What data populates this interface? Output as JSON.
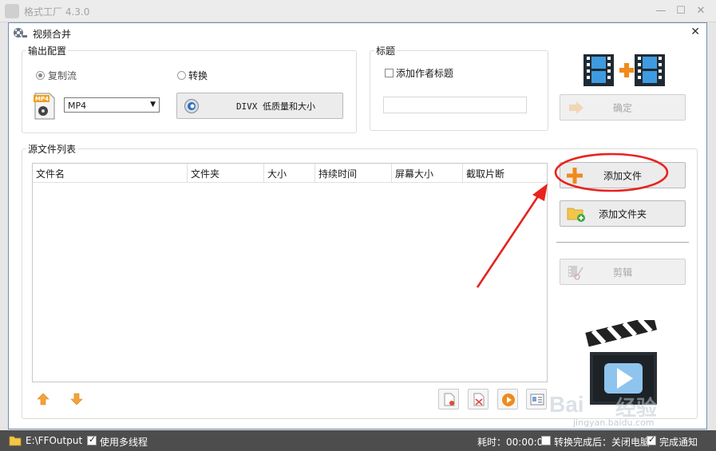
{
  "app": {
    "title": "格式工厂 4.3.0",
    "minimize": "—",
    "maximize": "☐",
    "close": "✕"
  },
  "dialog": {
    "title": "视频合并",
    "close": "✕",
    "output": {
      "group_label": "输出配置",
      "copy_stream_label": "复制流",
      "convert_label": "转换",
      "selected_mode": "复制流",
      "format_value": "MP4",
      "format_icon_text": "MP4",
      "quality_button": "DIVX 低质量和大小"
    },
    "title_group": {
      "group_label": "标题",
      "add_author_label": "添加作者标题",
      "add_author_checked": false,
      "title_value": ""
    },
    "confirm_button": "确定",
    "source_list": {
      "group_label": "源文件列表",
      "columns": [
        "文件名",
        "文件夹",
        "大小",
        "持续时间",
        "屏幕大小",
        "截取片断"
      ],
      "rows": []
    },
    "add_file_button": "添加文件",
    "add_folder_button": "添加文件夹",
    "clip_button": "剪辑",
    "icon_names": {
      "video_join": "film-plus-film-icon",
      "clapper": "clapperboard-play-icon"
    },
    "accent_colors": {
      "annotation_red": "#e8231e",
      "plus_orange": "#f08a1c",
      "arrow_up": "#f2a23a"
    }
  },
  "watermark": {
    "brand": "Bai",
    "brand2": "经验",
    "url": "jingyan.baidu.com"
  },
  "status": {
    "output_path": "E:\\FFOutput",
    "multithread_label": "使用多线程",
    "multithread_checked": true,
    "elapsed_label": "耗时：00:00:00",
    "after_convert_label": "转换完成后：关闭电脑",
    "after_convert_checked": false,
    "notify_label": "完成通知",
    "notify_checked": true
  }
}
